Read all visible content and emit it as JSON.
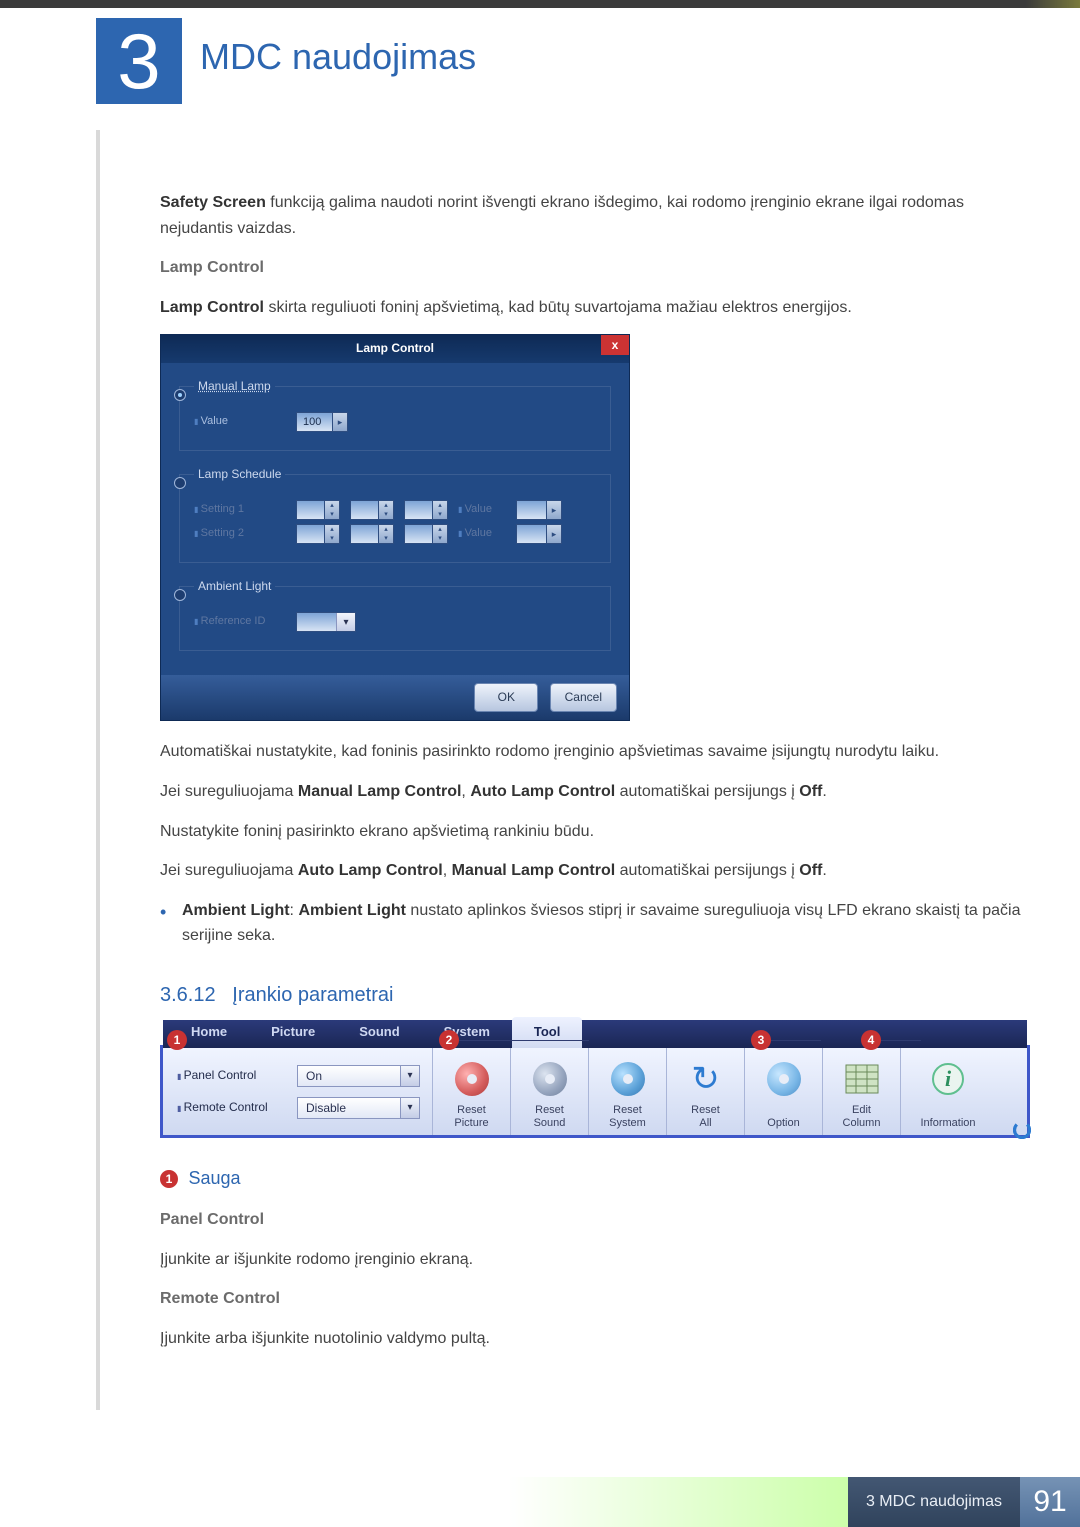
{
  "chapter_number": "3",
  "chapter_title": "MDC naudojimas",
  "safety_text_prefix": "Safety Screen",
  "safety_text_rest": " funkciją galima naudoti norint išvengti ekrano išdegimo, kai rodomo įrenginio ekrane ilgai rodomas nejudantis vaizdas.",
  "lamp": {
    "heading": "Lamp Control",
    "desc_prefix": "Lamp Control",
    "desc_rest": " skirta reguliuoti foninį apšvietimą, kad būtų suvartojama mažiau elektros energijos.",
    "dialog_title": "Lamp Control",
    "manual_legend": "Manual Lamp",
    "value_label": "Value",
    "value": "100",
    "schedule_legend": "Lamp Schedule",
    "setting1_label": "Setting 1",
    "setting2_label": "Setting 2",
    "schedule_value_label": "Value",
    "ambient_legend": "Ambient Light",
    "reference_label": "Reference ID",
    "ok": "OK",
    "cancel": "Cancel"
  },
  "para_auto": "Automatiškai nustatykite, kad foninis pasirinkto rodomo įrenginio apšvietimas savaime įsijungtų nurodytu laiku.",
  "para_manual_pre": "Jei sureguliuojama ",
  "para_manual_b1": "Manual Lamp Control",
  "para_manual_mid": ", ",
  "para_manual_b2": "Auto Lamp Control",
  "para_manual_post": " automatiškai persijungs į ",
  "para_manual_off": "Off",
  "para3": "Nustatykite foninį pasirinkto ekrano apšvietimą rankiniu būdu.",
  "para_auto2_pre": "Jei sureguliuojama ",
  "para_auto2_b1": "Auto Lamp Control",
  "para_auto2_mid": ", ",
  "para_auto2_b2": "Manual Lamp Control",
  "para_auto2_post": " automatiškai persijungs į ",
  "bullet_b1": "Ambient Light",
  "bullet_sep": ": ",
  "bullet_b2": "Ambient Light",
  "bullet_rest": " nustato aplinkos šviesos stiprį ir savaime sureguliuoja visų LFD ekrano skaistį ta pačia serijine seka.",
  "section_number": "3.6.12",
  "section_title": "Įrankio parametrai",
  "ribbon": {
    "tabs": [
      "Home",
      "Picture",
      "Sound",
      "System",
      "Tool"
    ],
    "active_tab": 4,
    "callouts": [
      "1",
      "2",
      "3",
      "4"
    ],
    "panel_control_label": "Panel Control",
    "panel_control_value": "On",
    "remote_control_label": "Remote Control",
    "remote_control_value": "Disable",
    "reset_picture": "Reset\nPicture",
    "reset_sound": "Reset\nSound",
    "reset_system": "Reset\nSystem",
    "reset_all": "Reset\nAll",
    "option": "Option",
    "edit_column": "Edit\nColumn",
    "information": "Information"
  },
  "sauga": {
    "badge": "1",
    "title": "Sauga",
    "panel_heading": "Panel Control",
    "panel_text": "Įjunkite ar išjunkite rodomo įrenginio ekraną.",
    "remote_heading": "Remote Control",
    "remote_text": "Įjunkite arba išjunkite nuotolinio valdymo pultą."
  },
  "footer_label": "3 MDC naudojimas",
  "footer_page": "91"
}
